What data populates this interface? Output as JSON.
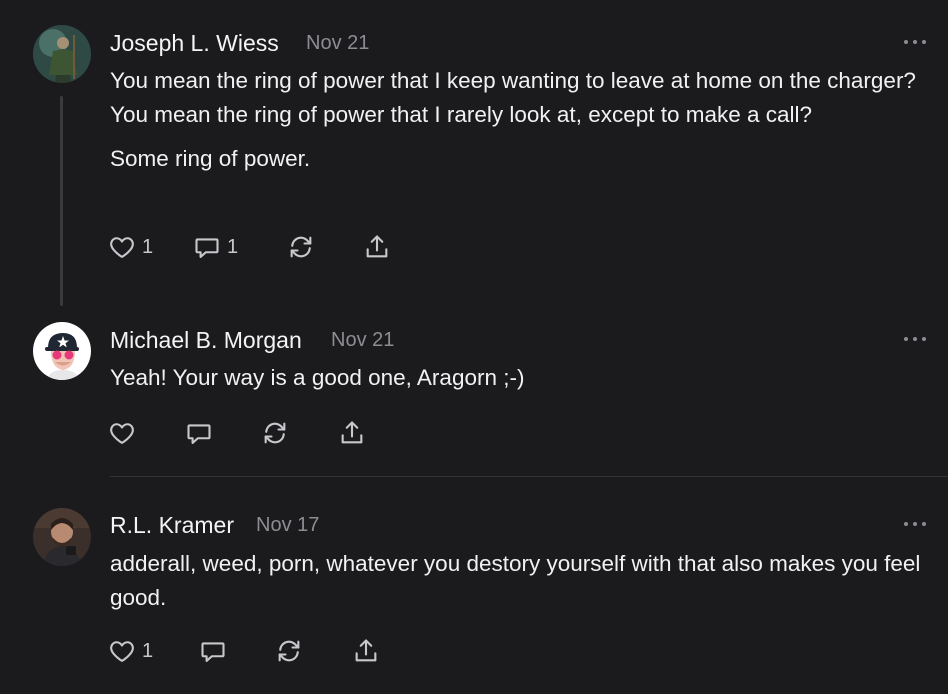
{
  "comments": [
    {
      "author": "Joseph L. Wiess",
      "date": "Nov 21",
      "paragraphs": [
        "You mean the ring of power that I keep wanting to leave at home on the charger? You mean the ring of power that I rarely look at, except to make a call?",
        "Some ring of power."
      ],
      "likes": "1",
      "replies": "1"
    },
    {
      "author": "Michael B. Morgan",
      "date": "Nov 21",
      "paragraphs": [
        "Yeah! Your way is a good one, Aragorn ;-)"
      ],
      "likes": "",
      "replies": ""
    },
    {
      "author": "R.L. Kramer",
      "date": "Nov 17",
      "paragraphs": [
        "adderall, weed, porn, whatever you destory yourself with that also makes you feel good."
      ],
      "likes": "1",
      "replies": ""
    }
  ],
  "icons": [
    "heart-icon",
    "comment-icon",
    "restack-icon",
    "share-icon",
    "more-icon"
  ],
  "colors": {
    "background": "#1b1b1e",
    "text": "#f2f2f2",
    "muted": "#8c8c92",
    "thread_line": "#3b3b3f"
  }
}
